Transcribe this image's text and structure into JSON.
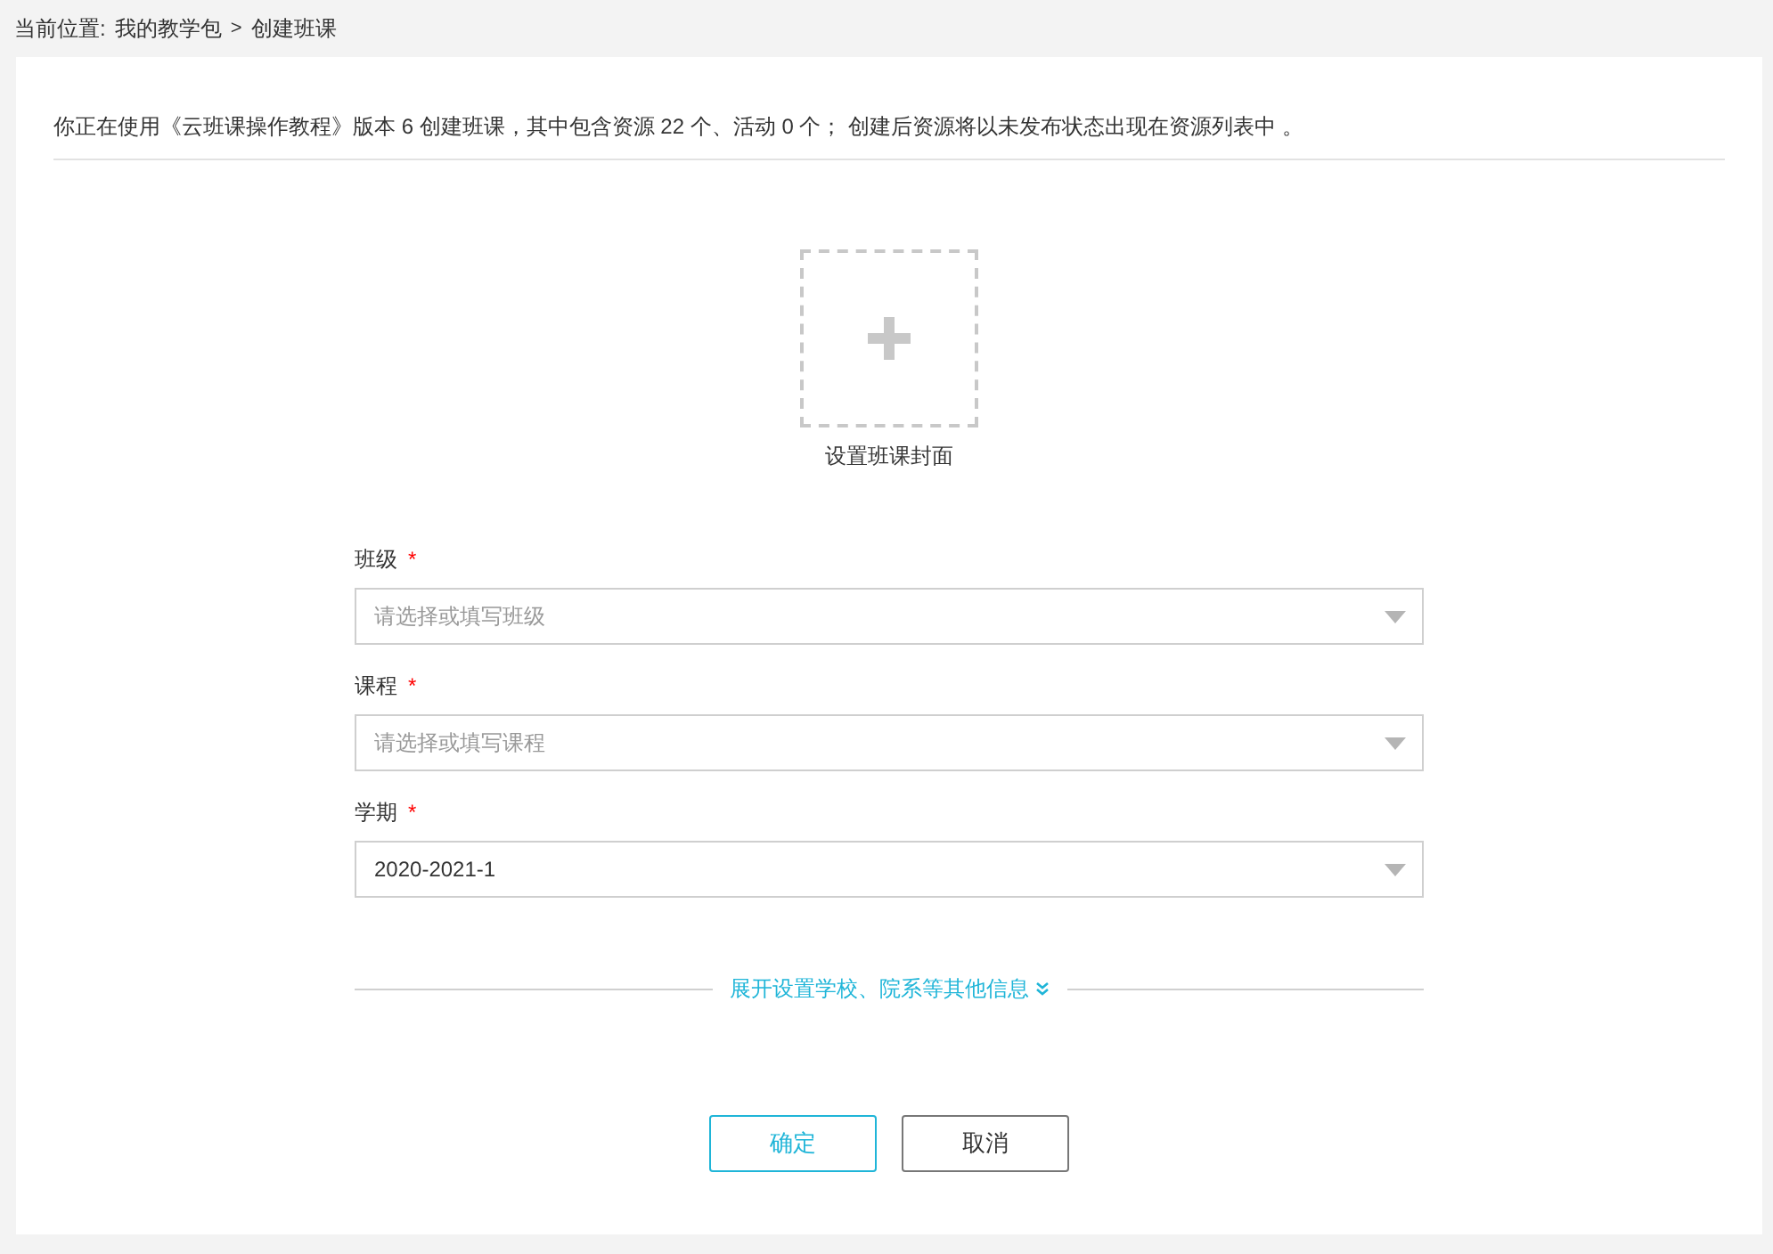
{
  "breadcrumb": {
    "label": "当前位置:",
    "items": [
      "我的教学包",
      "创建班课"
    ],
    "separator": ">"
  },
  "notice": "你正在使用《云班课操作教程》版本 6 创建班课，其中包含资源 22 个、活动 0 个； 创建后资源将以未发布状态出现在资源列表中 。",
  "cover": {
    "label": "设置班课封面"
  },
  "fields": [
    {
      "label": "班级",
      "required_mark": "*",
      "placeholder": "请选择或填写班级"
    },
    {
      "label": "课程",
      "required_mark": "*",
      "placeholder": "请选择或填写课程"
    },
    {
      "label": "学期",
      "required_mark": "*",
      "value": "2020-2021-1"
    }
  ],
  "expand_link": "展开设置学校、院系等其他信息",
  "buttons": [
    {
      "label": "确定",
      "kind": "primary"
    },
    {
      "label": "取消",
      "kind": "secondary"
    }
  ]
}
